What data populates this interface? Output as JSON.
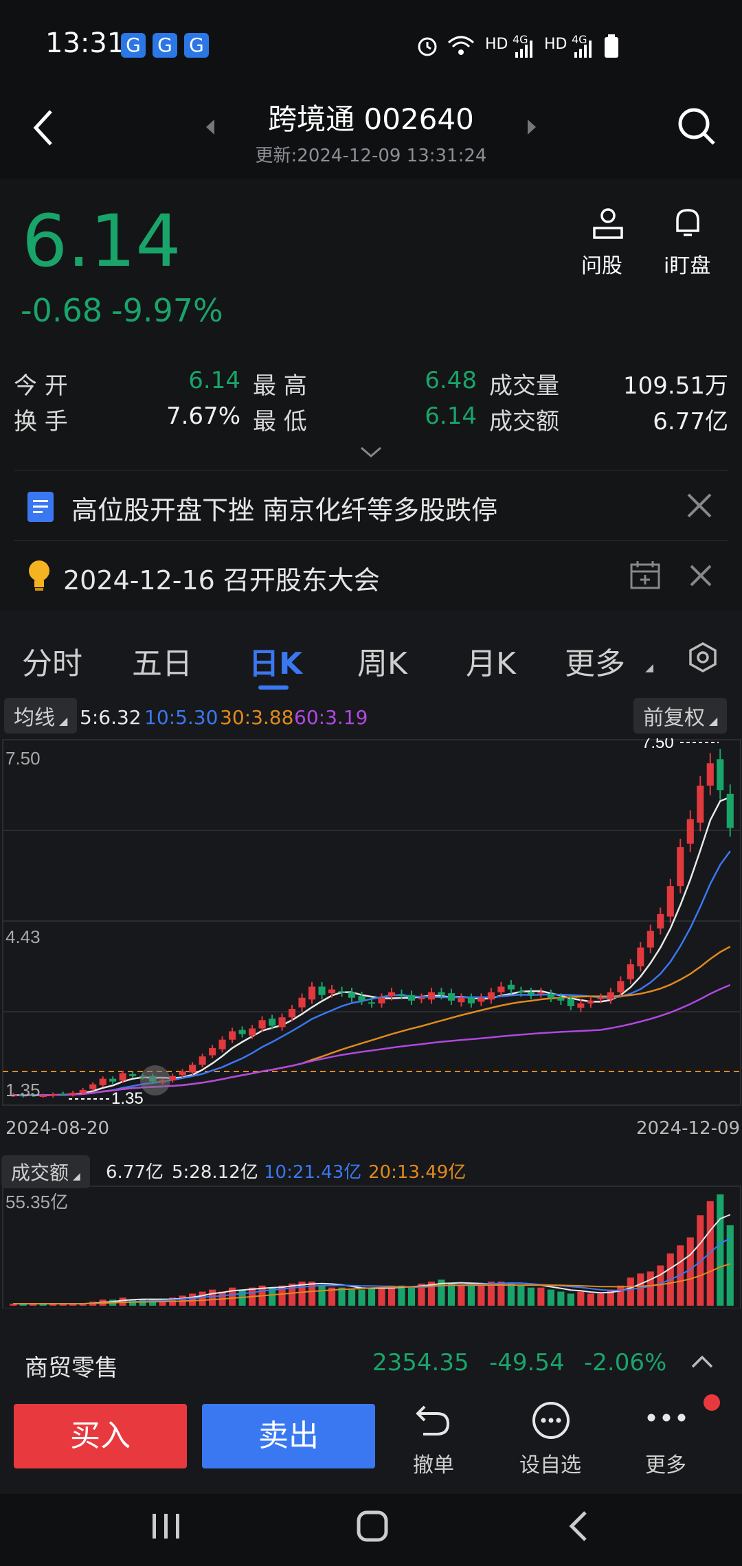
{
  "status_bar": {
    "time": "13:31",
    "app_icon_glyph": "G",
    "indicators": [
      "HD",
      "4G",
      "HD",
      "4G"
    ]
  },
  "header": {
    "title": "跨境通 002640",
    "updated": "更新:2024-12-09 13:31:24"
  },
  "quote": {
    "price": "6.14",
    "change": "-0.68",
    "change_pct": "-9.97%",
    "ask_label": "问股",
    "watch_label": "i盯盘",
    "stats": {
      "open_label": "今 开",
      "open": "6.14",
      "high_label": "最 高",
      "high": "6.48",
      "volume_label": "成交量",
      "volume": "109.51万",
      "turnover_label": "换 手",
      "turnover": "7.67%",
      "low_label": "最 低",
      "low": "6.14",
      "amount_label": "成交额",
      "amount": "6.77亿"
    }
  },
  "news": {
    "headline": "高位股开盘下挫 南京化纤等多股跌停",
    "event": "2024-12-16 召开股东大会"
  },
  "tabs": [
    "分时",
    "五日",
    "日K",
    "周K",
    "月K",
    "更多"
  ],
  "active_tab": "日K",
  "ma_bar": {
    "selector": "均线",
    "ma5": "5:6.32",
    "ma10": "10:5.30",
    "ma30": "30:3.88",
    "ma60": "60:3.19",
    "adjust": "前复权"
  },
  "kline_labels": {
    "top": "7.50",
    "mid": "4.43",
    "low": "1.35",
    "max_marker": "7.50",
    "min_marker": "1.35",
    "start_date": "2024-08-20",
    "end_date": "2024-12-09"
  },
  "volume_bar": {
    "selector": "成交额",
    "value": "6.77亿",
    "ma5": "5:28.12亿",
    "ma10": "10:21.43亿",
    "ma20": "20:13.49亿",
    "axis_max": "55.35亿"
  },
  "sector": {
    "name": "商贸零售",
    "index": "2354.35",
    "change": "-49.54",
    "change_pct": "-2.06%"
  },
  "actions": {
    "buy": "买入",
    "sell": "卖出",
    "cancel": "撤单",
    "watchlist": "设自选",
    "more": "更多"
  },
  "colors": {
    "up": "#e0393e",
    "down": "#19a46a",
    "ma5": "#e8e8e8",
    "ma10": "#3a78f2",
    "ma30": "#e08a1e",
    "ma60": "#b048e0",
    "buy": "#e8393f",
    "sell": "#3a78f2"
  },
  "chart_data": [
    {
      "type": "candlestick",
      "title": "",
      "x_start": "2024-08-20",
      "x_end": "2024-12-09",
      "ylim": [
        1.35,
        7.5
      ],
      "y_ticks": [
        7.5,
        4.43,
        1.35
      ],
      "close": [
        1.36,
        1.35,
        1.36,
        1.35,
        1.37,
        1.38,
        1.4,
        1.45,
        1.55,
        1.65,
        1.6,
        1.75,
        1.7,
        1.68,
        1.6,
        1.62,
        1.7,
        1.78,
        1.9,
        2.05,
        2.2,
        2.35,
        2.5,
        2.45,
        2.55,
        2.7,
        2.6,
        2.75,
        2.9,
        3.1,
        3.3,
        3.15,
        3.25,
        3.2,
        3.1,
        3.05,
        3.0,
        3.1,
        3.2,
        3.15,
        3.05,
        3.1,
        3.2,
        3.15,
        3.05,
        3.1,
        3.0,
        3.1,
        3.2,
        3.3,
        3.25,
        3.2,
        3.15,
        3.2,
        3.1,
        3.05,
        2.95,
        3.0,
        3.05,
        3.1,
        3.2,
        3.4,
        3.7,
        4.0,
        4.3,
        4.6,
        5.1,
        5.8,
        6.3,
        6.9,
        7.3,
        6.82,
        6.14
      ],
      "series": [
        {
          "name": "MA5",
          "last": 6.32
        },
        {
          "name": "MA10",
          "last": 5.3
        },
        {
          "name": "MA30",
          "last": 3.88
        },
        {
          "name": "MA60",
          "last": 3.19
        }
      ]
    },
    {
      "type": "bar",
      "title": "成交额",
      "ylim": [
        0,
        55.35
      ],
      "values": [
        1,
        1,
        1,
        1,
        1,
        1,
        1,
        1,
        2,
        3,
        3,
        4,
        3,
        3,
        3,
        3,
        4,
        5,
        6,
        7,
        8,
        7,
        9,
        8,
        9,
        10,
        9,
        10,
        11,
        12,
        12,
        10,
        9,
        9,
        8,
        8,
        9,
        9,
        10,
        10,
        9,
        11,
        12,
        13,
        11,
        10,
        10,
        11,
        12,
        12,
        11,
        10,
        9,
        9,
        8,
        7,
        6,
        7,
        6,
        6,
        8,
        10,
        14,
        16,
        17,
        20,
        26,
        30,
        34,
        45,
        52,
        55.35,
        40
      ]
    }
  ]
}
